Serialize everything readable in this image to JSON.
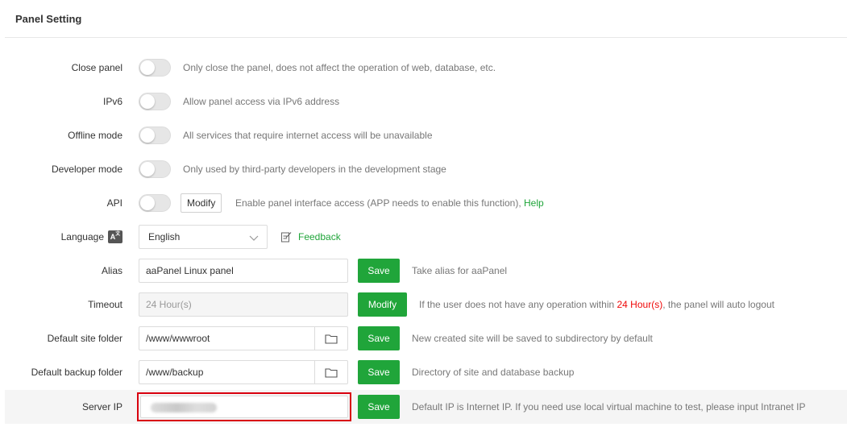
{
  "header": {
    "title": "Panel Setting"
  },
  "rows": {
    "close_panel": {
      "label": "Close panel",
      "desc": "Only close the panel, does not affect the operation of web, database, etc.",
      "enabled": false
    },
    "ipv6": {
      "label": "IPv6",
      "desc": "Allow panel access via IPv6 address",
      "enabled": false
    },
    "offline_mode": {
      "label": "Offline mode",
      "desc": "All services that require internet access will be unavailable",
      "enabled": false
    },
    "developer_mode": {
      "label": "Developer mode",
      "desc": "Only used by third-party developers in the development stage",
      "enabled": false
    },
    "api": {
      "label": "API",
      "button": "Modify",
      "desc": "Enable panel interface access (APP needs to enable this function), ",
      "help": "Help",
      "enabled": false
    },
    "language": {
      "label": "Language",
      "icon_glyph": "A",
      "selected": "English",
      "feedback": "Feedback"
    },
    "alias": {
      "label": "Alias",
      "value": "aaPanel Linux panel",
      "button": "Save",
      "desc": "Take alias for aaPanel"
    },
    "timeout": {
      "label": "Timeout",
      "value": "24 Hour(s)",
      "button": "Modify",
      "desc_before": "If the user does not have any operation within ",
      "desc_highlight": "24 Hour(s)",
      "desc_after": ", the panel will auto logout"
    },
    "default_site_folder": {
      "label": "Default site folder",
      "value": "/www/wwwroot",
      "button": "Save",
      "desc": "New created site will be saved to subdirectory by default"
    },
    "default_backup_folder": {
      "label": "Default backup folder",
      "value": "/www/backup",
      "button": "Save",
      "desc": "Directory of site and database backup"
    },
    "server_ip": {
      "label": "Server IP",
      "value": "",
      "button": "Save",
      "desc": "Default IP is Internet IP. If you need use local virtual machine to test, please input Intranet IP"
    }
  },
  "colors": {
    "accent": "#20a53a",
    "highlight_red": "#ef0808",
    "focus_border": "#d9000e"
  },
  "icons": {
    "language": "translate-icon",
    "feedback": "edit-note-icon",
    "folder": "folder-icon",
    "select": "chevron-down-icon"
  }
}
